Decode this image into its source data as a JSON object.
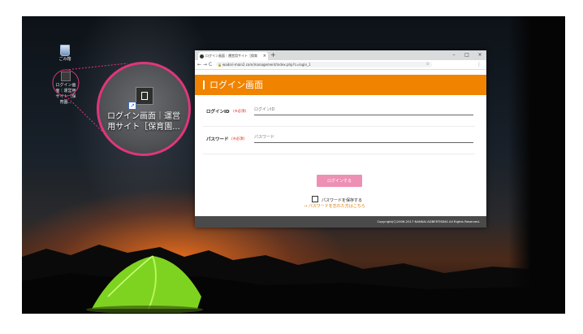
{
  "desktop": {
    "recycle_label": "ごみ箱",
    "shortcut_label": "ログイン画面｜運営用サイト［保育園…",
    "magnified_label_line1": "ログイン画面｜運営",
    "magnified_label_line2": "用サイト［保育園..."
  },
  "browser": {
    "tab_title": "ログイン画面｜運営用サイト［保育",
    "tab_close": "×",
    "new_tab": "+",
    "win_min": "–",
    "win_max": "□",
    "win_close": "×",
    "back": "←",
    "forward": "→",
    "reload": "C",
    "url": "wadori-main2.com/management/index.php?c=login_1",
    "star": "☆",
    "menu": "⋮"
  },
  "page": {
    "header_title": "ログイン画面",
    "login_id_label": "ログインID",
    "login_id_required": "(※必須)",
    "login_id_placeholder": "ログインID",
    "password_label": "パスワード",
    "password_required": "(※必須)",
    "password_placeholder": "パスワード",
    "login_button": "ログインする",
    "remember_label": "パスワードを保存する",
    "forgot_prefix": "→",
    "forgot_link": "パスワードを忘れた方はこちら",
    "footer": "Copyright(C)2006-2017 NANKAI ADBERTISING All Rights Reserved."
  },
  "colors": {
    "header_orange": "#f08300",
    "button_pink": "#ee8fb4",
    "lens_border": "#e0367a",
    "tabbar_teal": "#dadbdc"
  }
}
